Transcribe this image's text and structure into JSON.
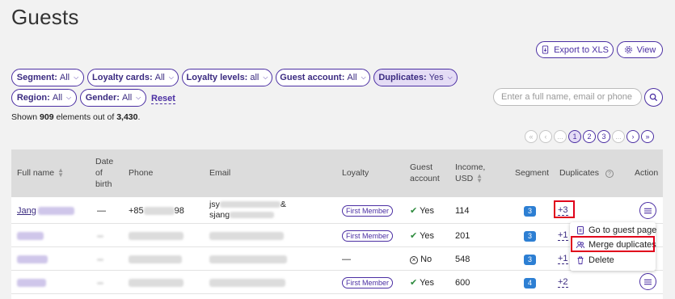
{
  "page": {
    "title": "Guests"
  },
  "toolbar": {
    "export_label": "Export to XLS",
    "view_label": "View"
  },
  "filters": [
    {
      "key": "Segment:",
      "value": "All"
    },
    {
      "key": "Loyalty cards:",
      "value": "All"
    },
    {
      "key": "Loyalty levels:",
      "value": "all"
    },
    {
      "key": "Guest account:",
      "value": "All"
    },
    {
      "key": "Duplicates:",
      "value": "Yes"
    },
    {
      "key": "Region:",
      "value": "All"
    },
    {
      "key": "Gender:",
      "value": "All"
    }
  ],
  "reset_label": "Reset",
  "search": {
    "placeholder": "Enter a full name, email or phone"
  },
  "summary": {
    "prefix": "Shown",
    "shown": "909",
    "middle": "elements out of",
    "total": "3,430",
    "suffix": "."
  },
  "pagination": {
    "first": "«",
    "prev": "‹",
    "ellipsis": "...",
    "pages": [
      "1",
      "2",
      "3"
    ],
    "next": "›",
    "last": "»",
    "current": "1"
  },
  "table": {
    "headers": {
      "full_name": "Full name",
      "dob": "Date of birth",
      "phone": "Phone",
      "email": "Email",
      "loyalty": "Loyalty",
      "guest_account": "Guest account",
      "income": "Income, USD",
      "segment": "Segment",
      "duplicates": "Duplicates",
      "action": "Action"
    },
    "rows": [
      {
        "name": "Jang",
        "dob": "—",
        "phone_start": "+85",
        "phone_end": "98",
        "email_line1": "jsy",
        "email_line1_end": "&",
        "email_line2": "sjang",
        "loyalty": "First Member",
        "account_icon": "check-circle-icon",
        "account": "Yes",
        "income": "114",
        "segment": "3",
        "duplicates": "+3"
      },
      {
        "name": "",
        "dob": "",
        "phone_start": "",
        "phone_end": "",
        "email_line1": "",
        "email_line1_end": "",
        "email_line2": "",
        "loyalty": "First Member",
        "account_icon": "check-circle-icon",
        "account": "Yes",
        "income": "201",
        "segment": "3",
        "duplicates": "+1"
      },
      {
        "name": "",
        "dob": "",
        "phone_start": "",
        "phone_end": "",
        "email_line1": "",
        "email_line1_end": "",
        "email_line2": "",
        "loyalty": "—",
        "account_icon": "x-circle-icon",
        "account": "No",
        "income": "548",
        "segment": "3",
        "duplicates": "+1"
      },
      {
        "name": "",
        "dob": "",
        "phone_start": "",
        "phone_end": "",
        "email_line1": "",
        "email_line1_end": "",
        "email_line2": "",
        "loyalty": "First Member",
        "account_icon": "check-circle-icon",
        "account": "Yes",
        "income": "600",
        "segment": "4",
        "duplicates": "+2"
      }
    ]
  },
  "context_menu": {
    "items": [
      {
        "label": "Go to guest page",
        "icon": "document-icon"
      },
      {
        "label": "Merge duplicates",
        "icon": "users-icon"
      },
      {
        "label": "Delete",
        "icon": "trash-icon"
      }
    ]
  },
  "colors": {
    "accent": "#4b2fa3",
    "segment": "#2d7fd3",
    "highlight": "#e0001b",
    "background": "#f2f2f2",
    "header": "#dcdcdc"
  }
}
